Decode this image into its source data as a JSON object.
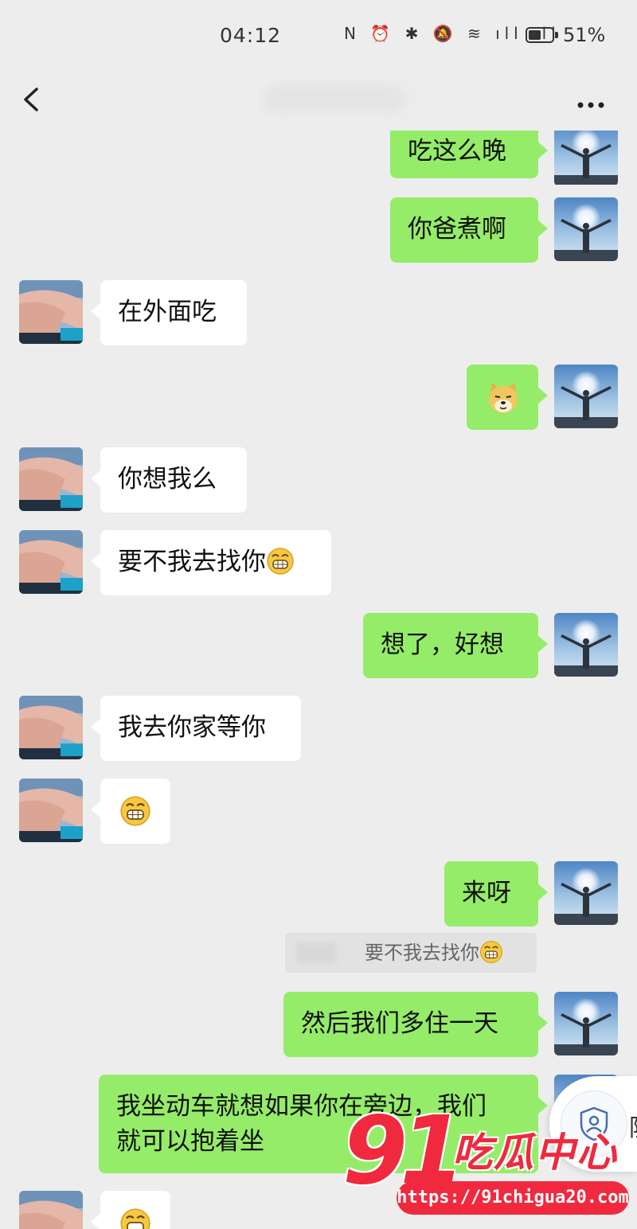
{
  "status": {
    "time": "04:12",
    "icons": "N ⏰ ✱ 🔕 ≋ ıll ıll",
    "battery_pct": "51%",
    "battery_level": 0.51
  },
  "nav": {
    "back_icon": "chevron-left-icon",
    "more_label": "···"
  },
  "messages": [
    {
      "from": "me",
      "text": "吃这么晚"
    },
    {
      "from": "me",
      "text": "你爸煮啊"
    },
    {
      "from": "her",
      "text": "在外面吃"
    },
    {
      "from": "me",
      "sticker": "doge-sticker"
    },
    {
      "from": "her",
      "text": "你想我么"
    },
    {
      "from": "her",
      "text": "要不我去找你",
      "emoji": "grin-emoji"
    },
    {
      "from": "me",
      "text": "想了，好想"
    },
    {
      "from": "her",
      "text": "我去你家等你"
    },
    {
      "from": "her",
      "emoji": "grin-emoji"
    },
    {
      "from": "me",
      "text": "来呀"
    },
    {
      "from": "me",
      "text": "然后我们多住一天"
    },
    {
      "from": "me",
      "text_line1": "我坐动车就想如果你在旁边，我们",
      "text_line2": "就可以抱着坐"
    },
    {
      "from": "her",
      "emoji": "grin-emoji"
    }
  ],
  "quote": {
    "text": "要不我去找你"
  },
  "security_widget": {
    "icon": "shield-user-icon",
    "edge_text": "防"
  },
  "watermark": {
    "brand_number": "91",
    "brand_name": "吃瓜中心",
    "url": "https://91chigua20.com"
  },
  "colors": {
    "my_bubble": "#95ec69",
    "her_bubble": "#ffffff",
    "background": "#ededed",
    "watermark": "#f0293f"
  }
}
